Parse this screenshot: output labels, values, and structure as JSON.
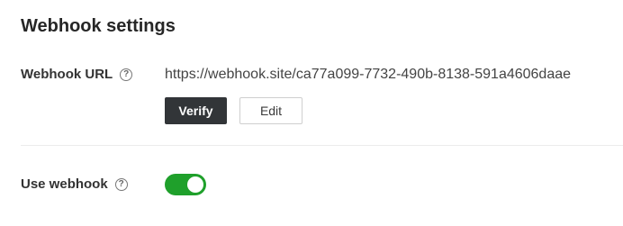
{
  "page": {
    "title": "Webhook settings"
  },
  "webhook_url": {
    "label": "Webhook URL",
    "help_icon": "question-circle",
    "value": "https://webhook.site/ca77a099-7732-490b-8138-591a4606daae",
    "verify_label": "Verify",
    "edit_label": "Edit"
  },
  "use_webhook": {
    "label": "Use webhook",
    "help_icon": "question-circle",
    "enabled": true
  },
  "colors": {
    "toggle_on": "#1fa02b",
    "primary_button": "#323538"
  }
}
